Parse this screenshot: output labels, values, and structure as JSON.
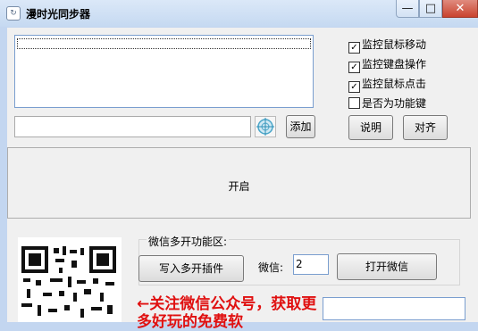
{
  "window": {
    "title": "漫时光同步器",
    "minimize_glyph": "—",
    "maximize_glyph": "□",
    "close_glyph": "✕"
  },
  "options": [
    {
      "label": "监控鼠标移动",
      "checked": true
    },
    {
      "label": "监控键盘操作",
      "checked": true
    },
    {
      "label": "监控鼠标点击",
      "checked": true
    },
    {
      "label": "是否为功能键",
      "checked": false
    }
  ],
  "buttons": {
    "add": "添加",
    "help": "说明",
    "align": "对齐",
    "start": "开启",
    "write_plugin": "写入多开插件",
    "open_wechat": "打开微信"
  },
  "wechat_group": {
    "title": "微信多开功能区:",
    "count_label": "微信:",
    "count_value": "2"
  },
  "promo_text": "←关注微信公众号，获取更多好玩的免费软",
  "icons": {
    "app": "app-icon",
    "crosshair": "crosshair-target-icon"
  }
}
